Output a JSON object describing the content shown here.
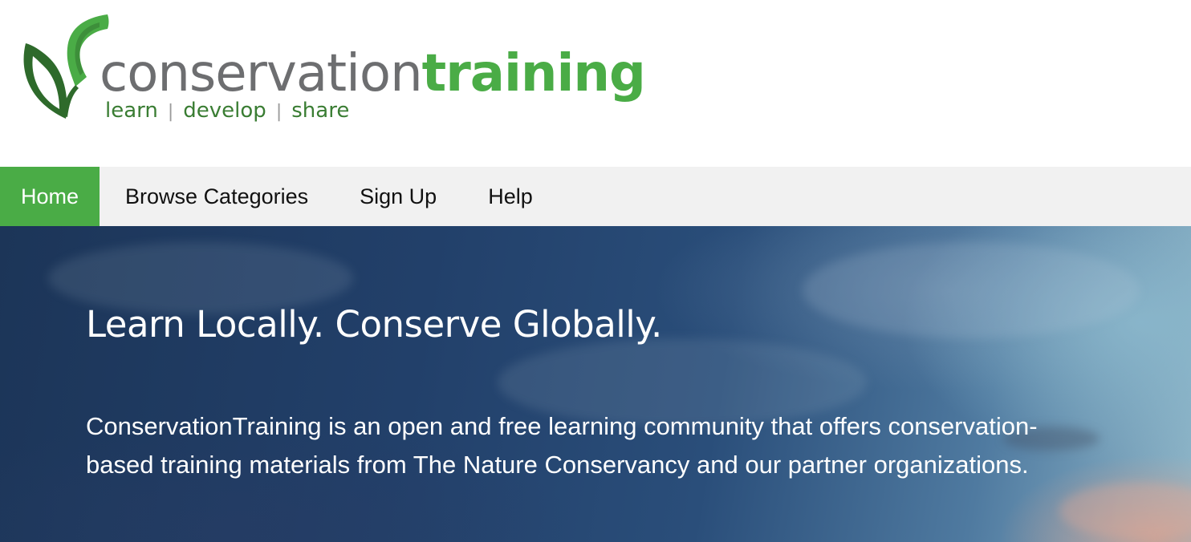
{
  "logo": {
    "word_part1": "conservation",
    "word_part2": "training",
    "tagline": [
      "learn",
      "develop",
      "share"
    ],
    "tagline_separator": "|",
    "icon": "leaf-sprout-icon",
    "colors": {
      "gray": "#6d6e70",
      "green": "#4aac46",
      "dark_green": "#2f6b2c"
    }
  },
  "nav": {
    "items": [
      {
        "label": "Home",
        "active": true
      },
      {
        "label": "Browse Categories",
        "active": false
      },
      {
        "label": "Sign Up",
        "active": false
      },
      {
        "label": "Help",
        "active": false
      }
    ],
    "active_color": "#4aac46",
    "background": "#f1f1f1"
  },
  "hero": {
    "title": "Learn Locally. Conserve Globally.",
    "description": "ConservationTraining is an open and free learning community that offers conservation-based training materials from The Nature Conservancy and our partner organizations."
  }
}
